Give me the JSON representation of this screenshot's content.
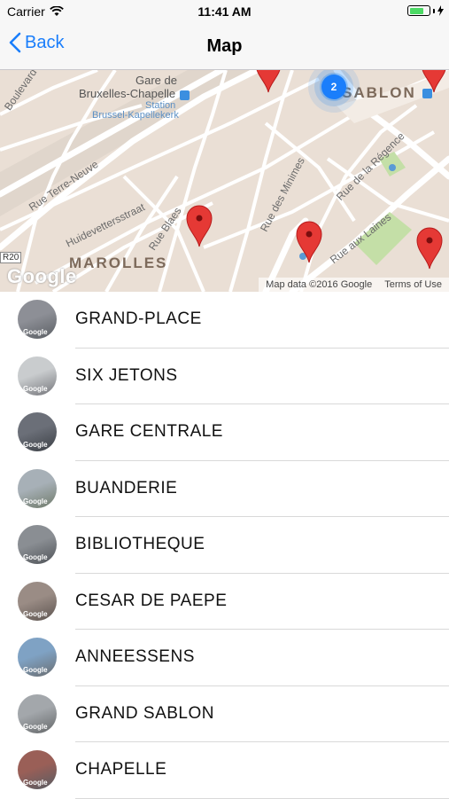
{
  "status": {
    "carrier": "Carrier",
    "time": "11:41 AM",
    "battery_level": 0.75
  },
  "nav": {
    "back_label": "Back",
    "title": "Map"
  },
  "map": {
    "streets": [
      "Gare de",
      "Bruxelles-Chapelle",
      "Station",
      "Brussel-Kapellekerk",
      "Boulevard M",
      "Rue Terre-Neuve",
      "Huidevettersstraat",
      "Rue Blaes",
      "Rue des Minimes",
      "Rue de la Régence",
      "Rue aux Laines",
      "R20"
    ],
    "districts": [
      "MAROLLES",
      "SABLON"
    ],
    "cluster_count": "2",
    "attribution": "Map data ©2016 Google",
    "terms": "Terms of Use",
    "logo": "Google"
  },
  "list": {
    "thumb_label": "Google",
    "items": [
      {
        "label": "GRAND-PLACE",
        "colors": [
          "#8d8f96",
          "#5a5e63"
        ]
      },
      {
        "label": "SIX JETONS",
        "colors": [
          "#c9ccce",
          "#74757a"
        ]
      },
      {
        "label": "GARE CENTRALE",
        "colors": [
          "#6b6f78",
          "#3b3f45"
        ]
      },
      {
        "label": "BUANDERIE",
        "colors": [
          "#a7b0b7",
          "#6f7a6a"
        ]
      },
      {
        "label": "BIBLIOTHEQUE",
        "colors": [
          "#8a8e93",
          "#4f5358"
        ]
      },
      {
        "label": "CESAR DE PAEPE",
        "colors": [
          "#9a8c85",
          "#5c534f"
        ]
      },
      {
        "label": "ANNEESSENS",
        "colors": [
          "#7fa2c4",
          "#6a6d70"
        ]
      },
      {
        "label": "GRAND SABLON",
        "colors": [
          "#a3a7ab",
          "#646769"
        ]
      },
      {
        "label": "CHAPELLE",
        "colors": [
          "#9a5f57",
          "#565c63"
        ]
      }
    ]
  },
  "colors": {
    "accent": "#1a7efb",
    "pin": "#e53935",
    "park": "#c4dfa7",
    "road": "#ffffff",
    "land": "#eadfd5"
  }
}
